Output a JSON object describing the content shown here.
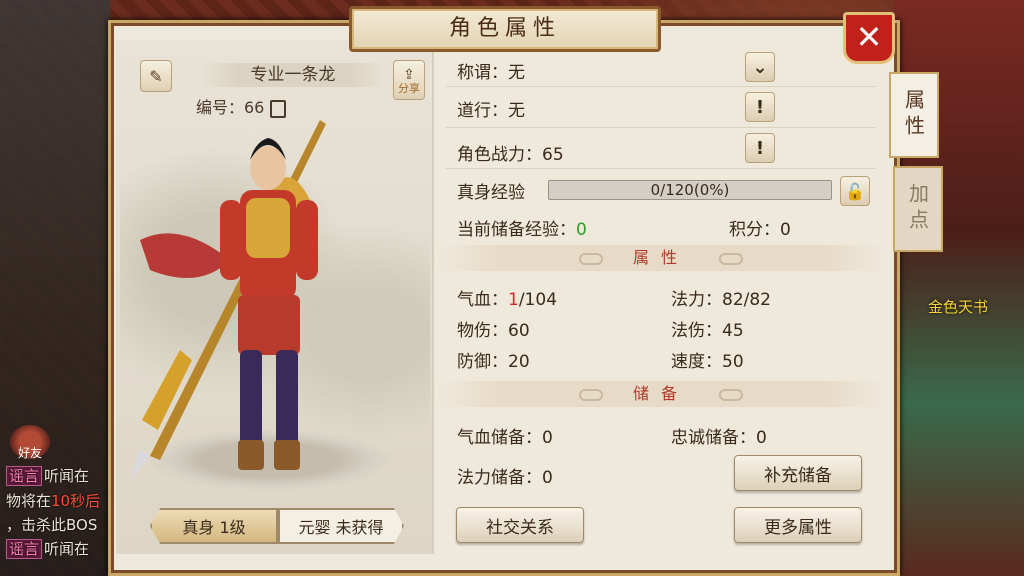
{
  "window": {
    "title": "角色属性"
  },
  "side_tabs": [
    {
      "label": "属性",
      "active": true
    },
    {
      "label": "加点",
      "active": false
    }
  ],
  "character": {
    "name": "专业一条龙",
    "id_label": "编号：66",
    "share_label": "分享"
  },
  "bottom_tabs": [
    {
      "label": "真身 1级",
      "active": true
    },
    {
      "label": "元婴 未获得",
      "active": false
    }
  ],
  "info": {
    "title_label": "称谓：无",
    "daoxing_label": "道行：无",
    "power_label": "角色战力：",
    "power_value": "65",
    "exp_label": "真身经验",
    "exp_text": "0/120(0%)",
    "exp_fraction": 0,
    "stored_exp_label": "当前储备经验：",
    "stored_exp_value": "0",
    "score_label": "积分：",
    "score_value": "0"
  },
  "attributes": {
    "header": "属性",
    "hp_label": "气血：",
    "hp_current": "1",
    "hp_max": "/104",
    "mp_label": "法力：",
    "mp_value": "82/82",
    "phys_label": "物伤：",
    "phys_value": "60",
    "mag_label": "法伤：",
    "mag_value": "45",
    "def_label": "防御：",
    "def_value": "20",
    "spd_label": "速度：",
    "spd_value": "50"
  },
  "reserve": {
    "header": "储备",
    "hp_label": "气血储备：",
    "hp_value": "0",
    "loyalty_label": "忠诚储备：",
    "loyalty_value": "0",
    "mp_label": "法力储备：",
    "mp_value": "0",
    "refill_button": "补充储备"
  },
  "buttons": {
    "social": "社交关系",
    "more": "更多属性"
  },
  "background": {
    "chat_tag": "谣言",
    "chat_line1": "听闻在",
    "chat_line2_a": "物将在",
    "chat_line2_b": "10秒后",
    "chat_line3": "，击杀此BOS",
    "chat_line4": "听闻在",
    "friends_label": "好友",
    "gold_book": "金色天书"
  },
  "colors": {
    "accent_red": "#c0211b",
    "gold_border": "#c9a865",
    "exp_green": "#2aa02a"
  }
}
